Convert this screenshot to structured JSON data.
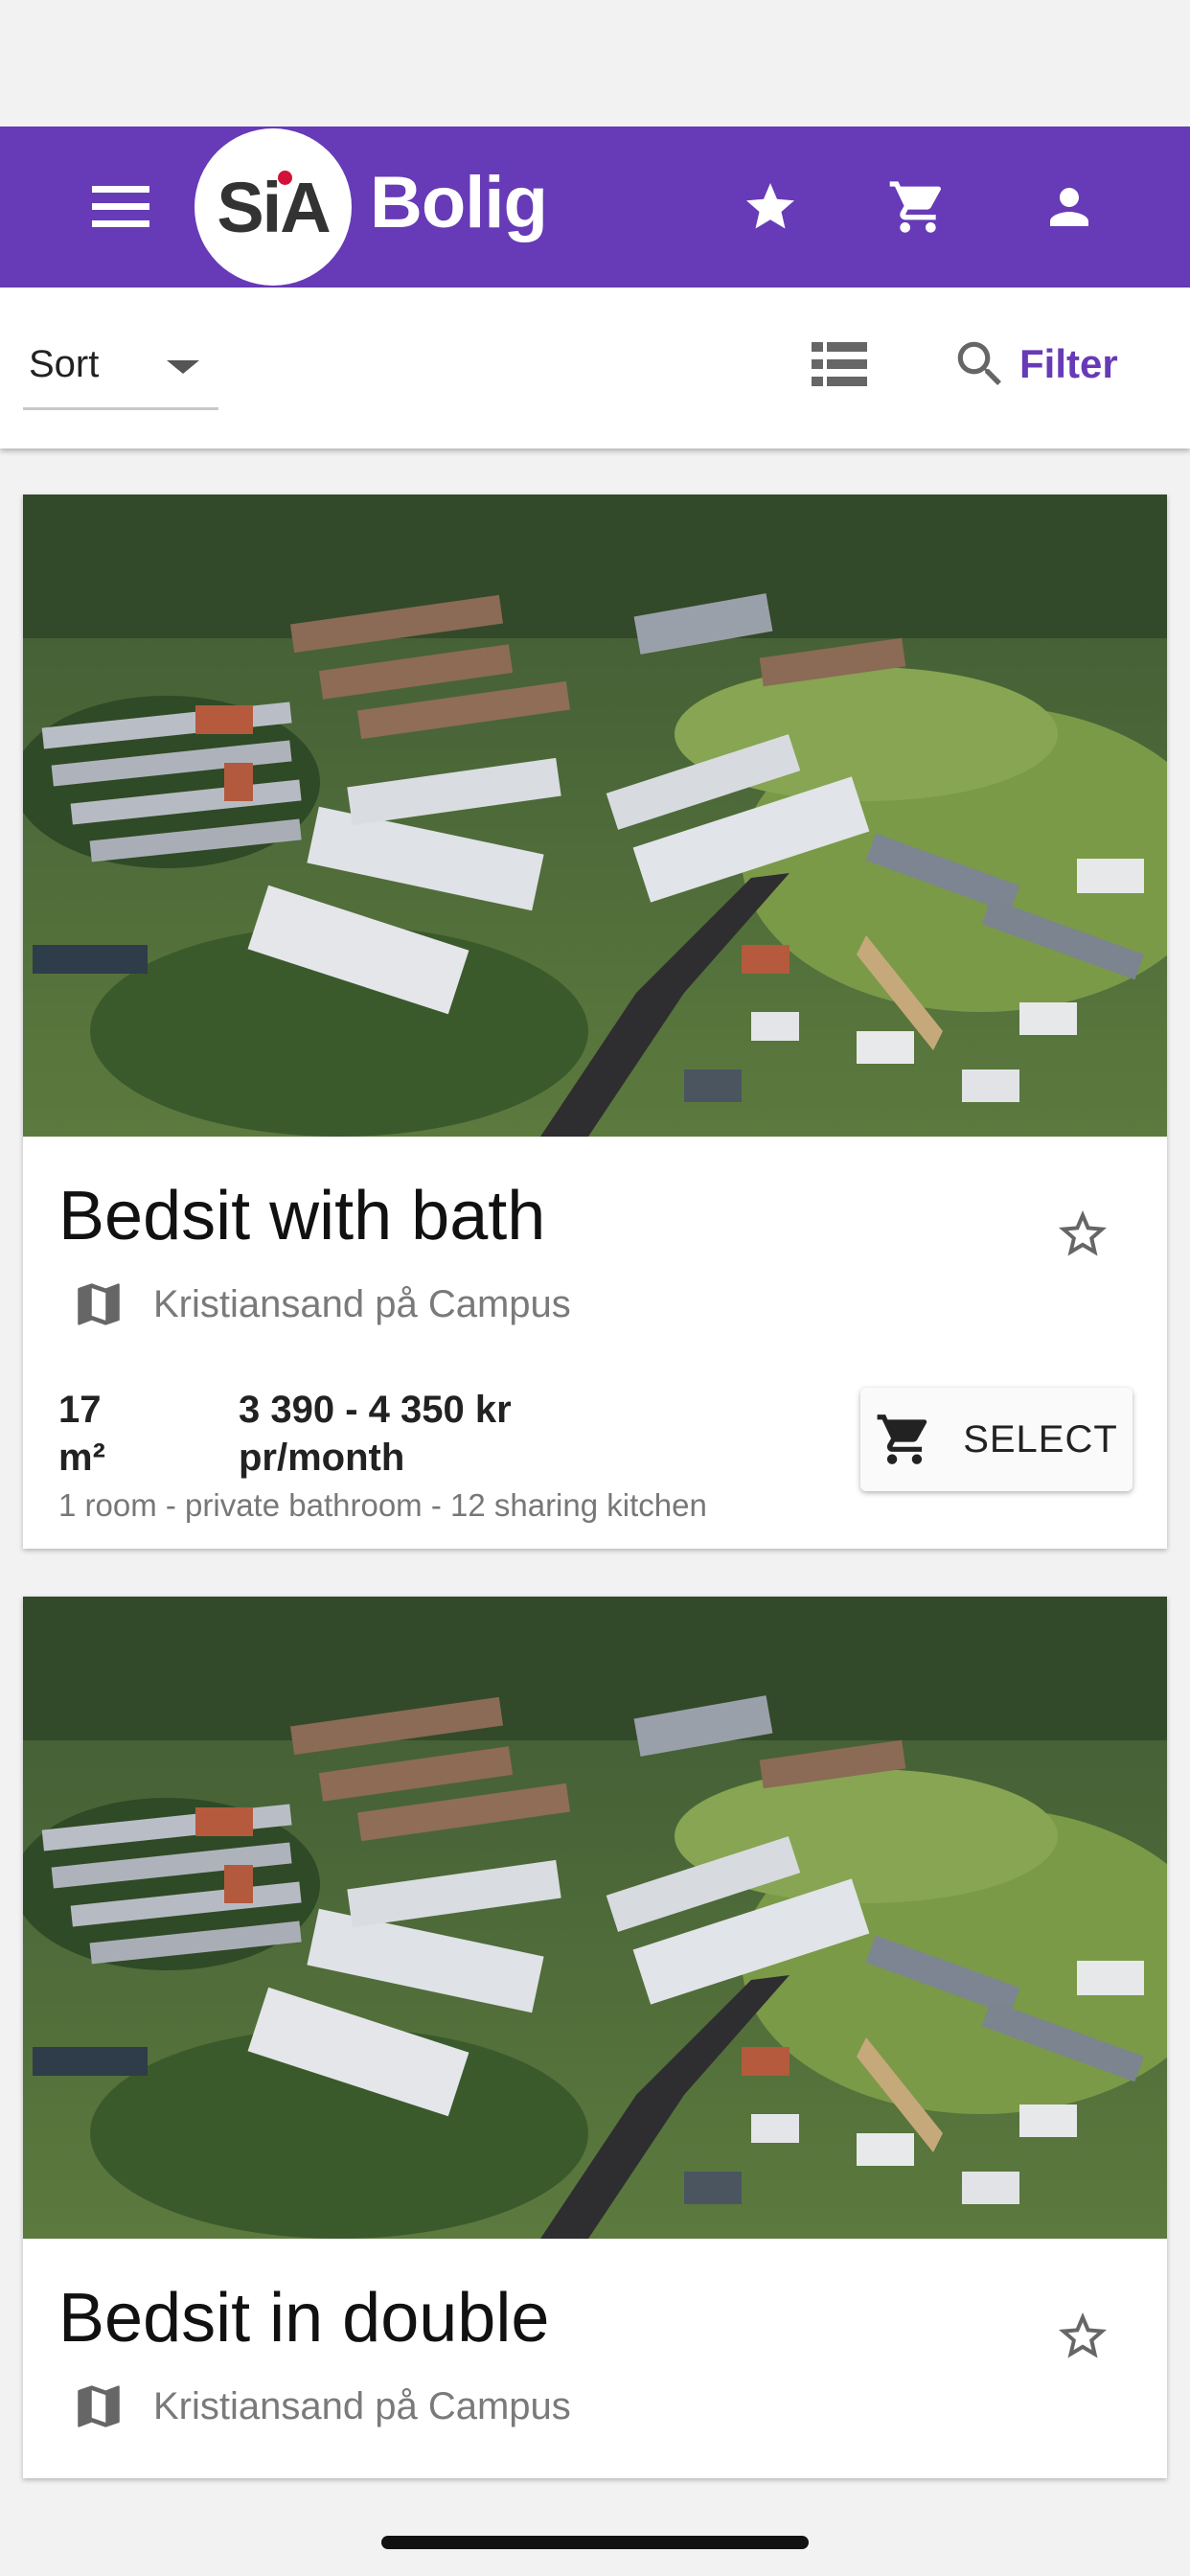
{
  "app": {
    "logo_mark": "SiA",
    "logo_text": "Bolig",
    "brand_color": "#673ab7"
  },
  "header": {
    "icons": [
      "menu-icon",
      "star-icon",
      "cart-icon",
      "account-icon"
    ]
  },
  "toolbar": {
    "sort_label": "Sort",
    "filter_label": "Filter"
  },
  "listings": [
    {
      "title": "Bedsit with bath",
      "location": "Kristiansand på Campus",
      "size_value": "17",
      "size_unit": "m²",
      "price_range": "3 390 - 4 350 kr",
      "price_period": "pr/month",
      "description": "1 room - private bathroom - 12 sharing kitchen",
      "select_label": "SELECT"
    },
    {
      "title": "Bedsit in double",
      "location": "Kristiansand på Campus"
    }
  ]
}
